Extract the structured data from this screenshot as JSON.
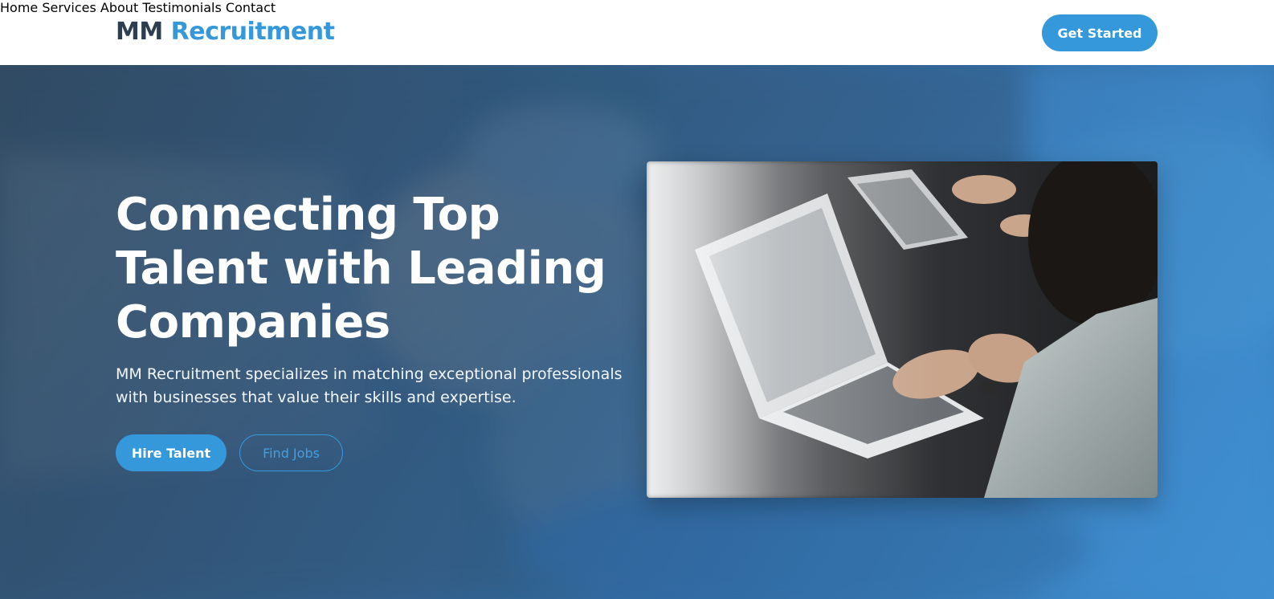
{
  "brand": {
    "part1": "MM",
    "part2": "Recruitment"
  },
  "nav": {
    "items": [
      {
        "label": "Home"
      },
      {
        "label": "Services"
      },
      {
        "label": "About"
      },
      {
        "label": "Testimonials"
      },
      {
        "label": "Contact"
      }
    ],
    "cta_label": "Get Started"
  },
  "hero": {
    "headline": "Connecting Top Talent with Leading Companies",
    "subtext": "MM Recruitment specializes in matching exceptional professionals with businesses that value their skills and expertise.",
    "primary_button": "Hire Talent",
    "secondary_button": "Find Jobs"
  },
  "colors": {
    "brand_dark": "#2c3e50",
    "accent": "#3498db",
    "header_bg": "#ffffff"
  }
}
